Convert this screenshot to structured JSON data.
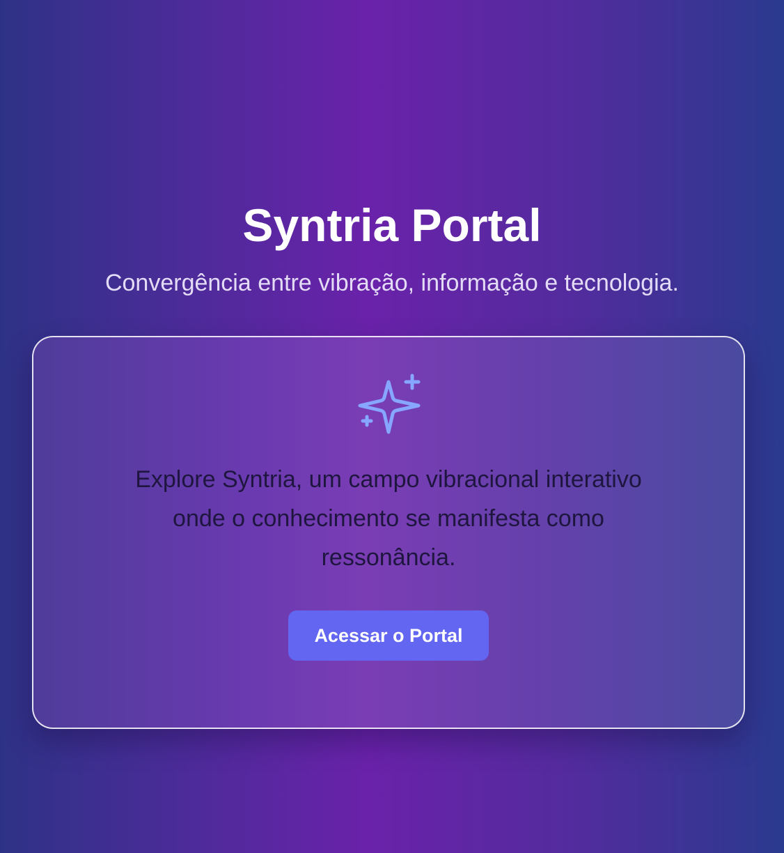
{
  "hero": {
    "title": "Syntria Portal",
    "subtitle": "Convergência entre vibração, informação e tecnologia."
  },
  "card": {
    "icon": "sparkles-icon",
    "description": "Explore Syntria, um campo vibracional interativo onde o conhecimento se manifesta como ressonância.",
    "button_label": "Acessar o Portal"
  },
  "colors": {
    "background_left": "#2e3286",
    "background_center": "#6a22aa",
    "background_right": "#2a3a8e",
    "button": "#6266f0",
    "icon": "#86a6ff",
    "card_text": "#1f1640"
  }
}
